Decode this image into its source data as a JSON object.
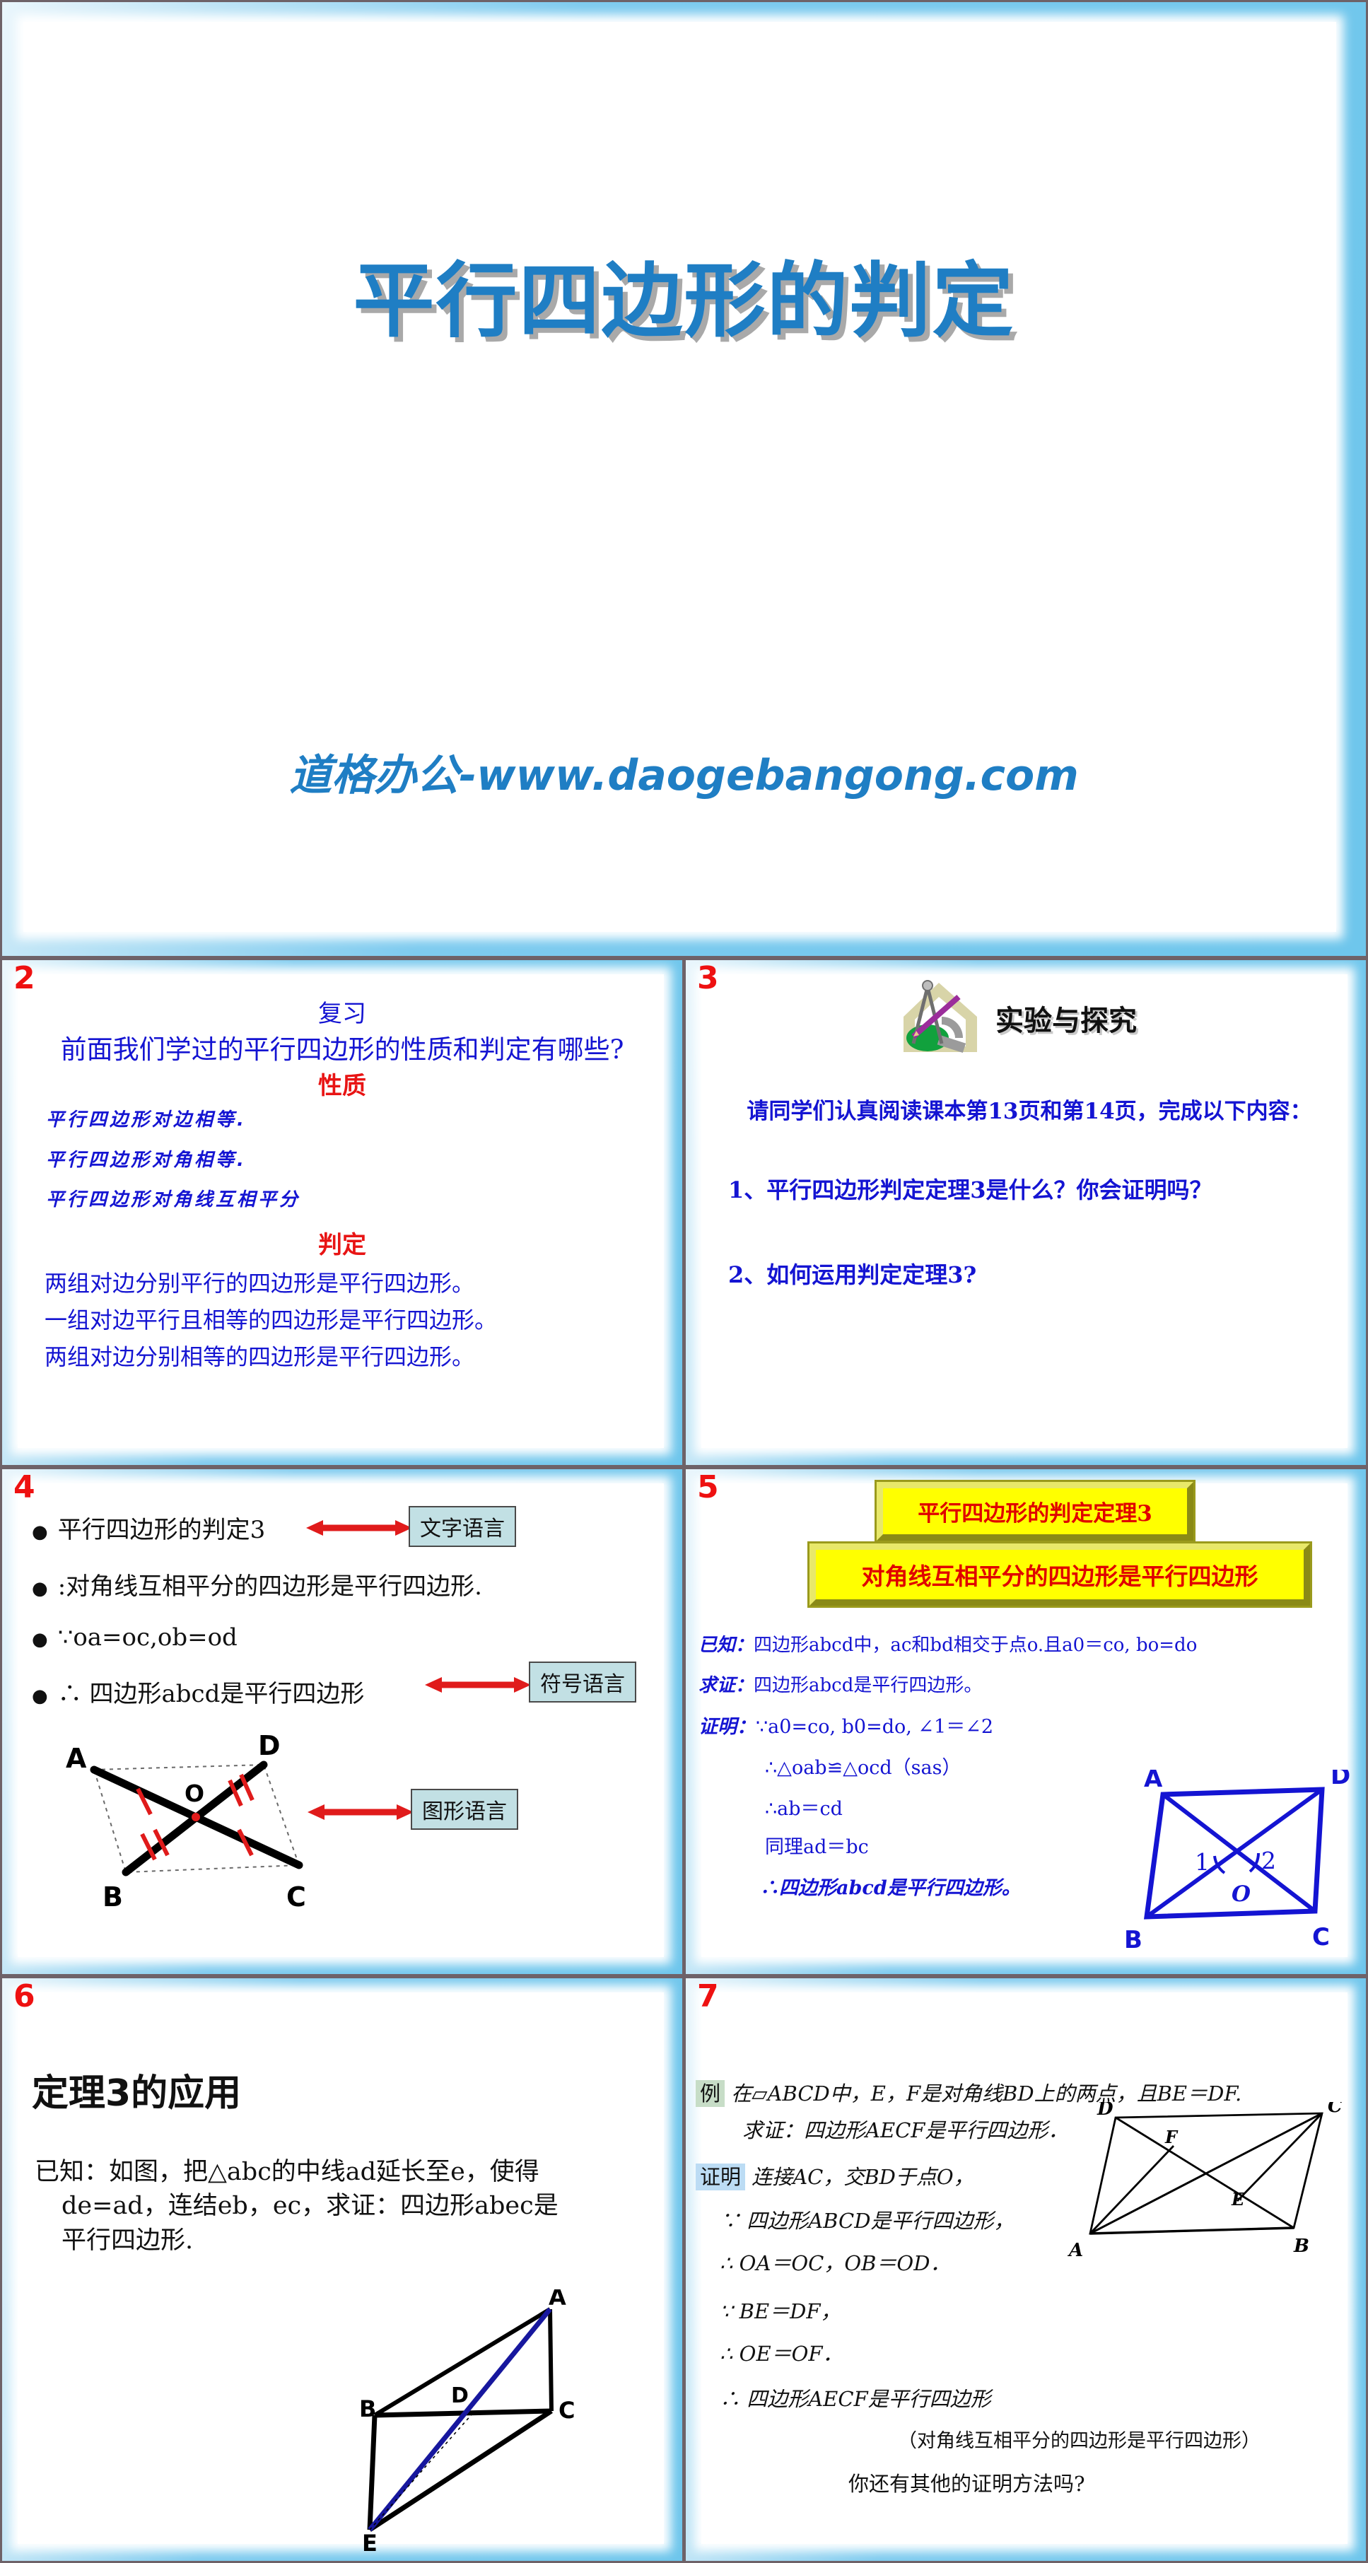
{
  "deck": {
    "title": "平行四边形的判定",
    "watermark": "道格办公-www.daogebangong.com",
    "accent_blue": "#1f7ec4",
    "frame_blue": "#6ec6ec",
    "page_number_color": "#ee1111"
  },
  "slides": [
    {
      "number": "",
      "title": "平行四边形的判定",
      "watermark": "道格办公-www.daogebangong.com"
    },
    {
      "number": "2",
      "heading": "复习",
      "question": "前面我们学过的平行四边形的性质和判定有哪些?",
      "section_properties": "性质",
      "properties": [
        "平行四边形对边相等.",
        "平行四边形对角相等.",
        "平行四边形对角线互相平分"
      ],
      "section_criteria": "判定",
      "criteria": [
        "两组对边分别平行的四边形是平行四边形。",
        "一组对边平行且相等的四边形是平行四边形。",
        "两组对边分别相等的四边形是平行四边形。"
      ]
    },
    {
      "number": "3",
      "banner_label": "实验与探究",
      "banner_icon": "compass-ruler-icon",
      "read_instruction": "请同学们认真阅读课本第13页和第14页，完成以下内容：",
      "questions": [
        "1、平行四边形判定定理3是什么？你会证明吗？",
        "2、如何运用判定定理3?"
      ]
    },
    {
      "number": "4",
      "lines": [
        "平行四边形的判定3",
        ":对角线互相平分的四边形是平行四边形.",
        "∵oa=oc,ob=od",
        "∴ 四边形abcd是平行四边形"
      ],
      "tags": [
        "文字语言",
        "符号语言",
        "图形语言"
      ],
      "figure_labels": [
        "A",
        "D",
        "O",
        "B",
        "C"
      ]
    },
    {
      "number": "5",
      "box_title": "平行四边形的判定定理3",
      "box_statement": "对角线互相平分的四边形是平行四边形",
      "given_label": "已知：",
      "given_text": "四边形abcd中，ac和bd相交于点o.且a0＝co, bo=do",
      "prove_label": "求证：",
      "prove_text": "四边形abcd是平行四边形。",
      "proof_label": "证明：",
      "proof_lines": [
        "∵a0=co, b0=do, ∠1＝∠2",
        "∴△oab≌△ocd（sas）",
        "∴ab＝cd",
        "同理ad＝bc",
        "∴四边形abcd是平行四边形。"
      ],
      "figure_labels": [
        "A",
        "D",
        "1",
        "2",
        "O",
        "B",
        "C"
      ]
    },
    {
      "number": "6",
      "title": "定理3的应用",
      "given": "已知：如图，把△abc的中线ad延长至e，使得",
      "given_2": "de=ad，连结eb，ec，求证：四边形abec是",
      "given_3": "平行四边形.",
      "figure_labels": [
        "A",
        "B",
        "D",
        "C",
        "E"
      ]
    },
    {
      "number": "7",
      "example_tag": "例",
      "example_text": "在▱ABCD中，E，F是对角线BD上的两点，且BE＝DF.",
      "example_prove": "求证：四边形AECF是平行四边形．",
      "proof_tag": "证明",
      "proof_intro": "连接AC，交BD于点O，",
      "proof_lines": [
        "∵  四边形ABCD是平行四边形，",
        "∴  OA＝OC，OB＝OD．",
        "∵  BE＝DF，",
        "∴  OE＝OF．",
        "∴  四边形AECF是平行四边形"
      ],
      "note": "（对角线互相平分的四边形是平行四边形）",
      "closing_question": "你还有其他的证明方法吗?",
      "figure_labels": [
        "D",
        "C",
        "F",
        "E",
        "A",
        "B"
      ]
    }
  ]
}
